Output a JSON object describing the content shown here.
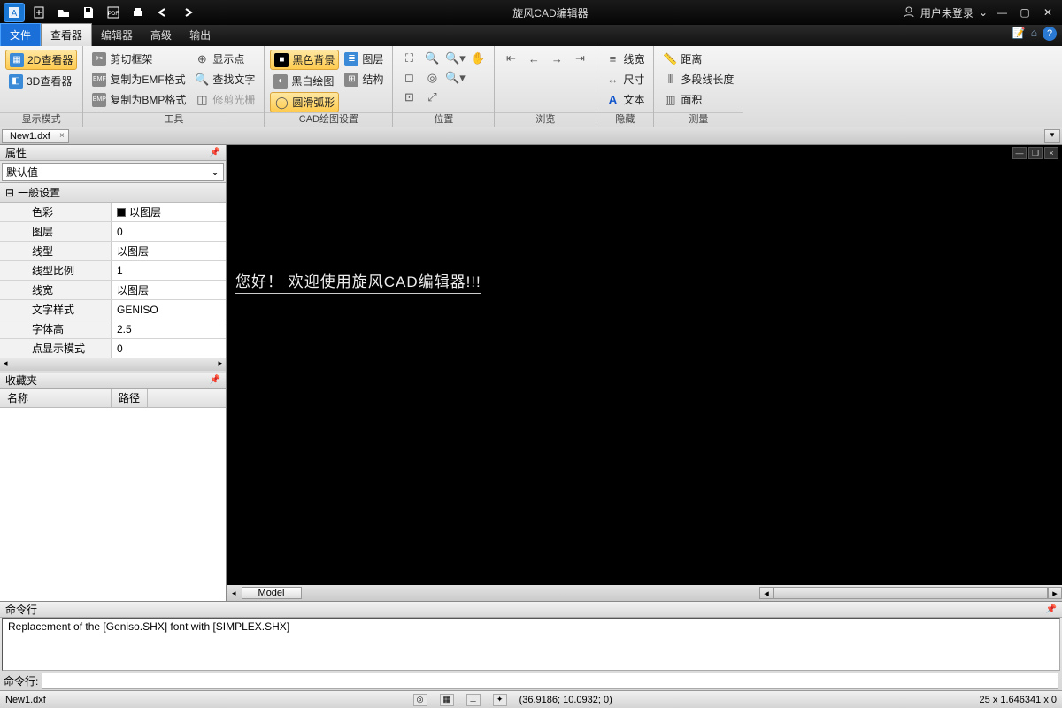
{
  "titlebar": {
    "title": "旋风CAD编辑器",
    "user": "用户未登录"
  },
  "menus": {
    "file": "文件",
    "viewer": "查看器",
    "editor": "编辑器",
    "advanced": "高级",
    "output": "输出"
  },
  "ribbon": {
    "displayMode": {
      "label": "显示模式",
      "viewer2d": "2D查看器",
      "viewer3d": "3D查看器"
    },
    "tools": {
      "label": "工具",
      "crop": "剪切框架",
      "copyEmf": "复制为EMF格式",
      "copyBmp": "复制为BMP格式",
      "showPoint": "显示点",
      "findText": "查找文字",
      "editManual": "修剪光栅"
    },
    "cadSettings": {
      "label": "CAD绘图设置",
      "blackBg": "黑色背景",
      "bwPlot": "黑白绘图",
      "smoothArc": "圆滑弧形",
      "layers": "图层",
      "structure": "结构"
    },
    "position": {
      "label": "位置"
    },
    "browse": {
      "label": "浏览"
    },
    "hide": {
      "label": "隐藏",
      "lineWidth": "线宽",
      "dimension": "尺寸",
      "text": "文本"
    },
    "measure": {
      "label": "测量",
      "distance": "距离",
      "polyLen": "多段线长度",
      "area": "面积"
    }
  },
  "docTab": "New1.dxf",
  "propPanel": {
    "title": "属性",
    "default": "默认值",
    "section": "一般设置",
    "rows": {
      "color": {
        "k": "色彩",
        "v": "以图层"
      },
      "layer": {
        "k": "图层",
        "v": "0"
      },
      "linetype": {
        "k": "线型",
        "v": "以图层"
      },
      "ltscale": {
        "k": "线型比例",
        "v": "1"
      },
      "lineweight": {
        "k": "线宽",
        "v": "以图层"
      },
      "textstyle": {
        "k": "文字样式",
        "v": "GENISO"
      },
      "textheight": {
        "k": "字体高",
        "v": "2.5"
      },
      "pointmode": {
        "k": "点显示模式",
        "v": "0"
      }
    }
  },
  "favorites": {
    "title": "收藏夹",
    "colName": "名称",
    "colPath": "路径"
  },
  "canvas": {
    "welcome": "您好！ 欢迎使用旋风CAD编辑器!!!",
    "modelTab": "Model"
  },
  "command": {
    "title": "命令行",
    "log": "Replacement of the [Geniso.SHX] font with [SIMPLEX.SHX]",
    "prompt": "命令行:"
  },
  "status": {
    "file": "New1.dxf",
    "coords": "(36.9186; 10.0932; 0)",
    "scale": "25 x 1.646341 x 0"
  }
}
